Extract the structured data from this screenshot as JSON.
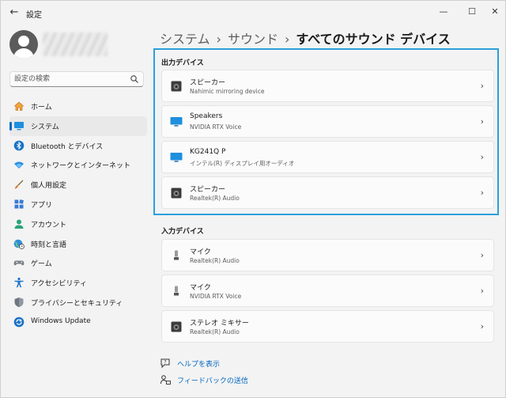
{
  "window": {
    "title": "設定",
    "back": "←",
    "controls": {
      "minimize": "—",
      "maximize": "☐",
      "close": "✕"
    }
  },
  "search": {
    "placeholder": "設定の検索"
  },
  "sidebar": {
    "items": [
      {
        "label": "ホーム",
        "icon": "home-icon",
        "active": false
      },
      {
        "label": "システム",
        "icon": "display-icon",
        "active": true
      },
      {
        "label": "Bluetooth とデバイス",
        "icon": "bluetooth-icon",
        "active": false
      },
      {
        "label": "ネットワークとインターネット",
        "icon": "wifi-icon",
        "active": false
      },
      {
        "label": "個人用設定",
        "icon": "brush-icon",
        "active": false
      },
      {
        "label": "アプリ",
        "icon": "apps-icon",
        "active": false
      },
      {
        "label": "アカウント",
        "icon": "person-icon",
        "active": false
      },
      {
        "label": "時刻と言語",
        "icon": "globe-clock-icon",
        "active": false
      },
      {
        "label": "ゲーム",
        "icon": "gamepad-icon",
        "active": false
      },
      {
        "label": "アクセシビリティ",
        "icon": "accessibility-icon",
        "active": false
      },
      {
        "label": "プライバシーとセキュリティ",
        "icon": "shield-icon",
        "active": false
      },
      {
        "label": "Windows Update",
        "icon": "windows-update-icon",
        "active": false
      }
    ]
  },
  "breadcrumb": {
    "items": [
      "システム",
      "サウンド"
    ],
    "current": "すべてのサウンド デバイス",
    "separator": "›"
  },
  "output_section": {
    "title": "出力デバイス",
    "devices": [
      {
        "name": "スピーカー",
        "sub": "Nahimic mirroring device",
        "icon": "speaker-icon"
      },
      {
        "name": "Speakers",
        "sub": "NVIDIA RTX Voice",
        "icon": "monitor-icon"
      },
      {
        "name": "KG241Q P",
        "sub": "インテル(R) ディスプレイ用オーディオ",
        "icon": "monitor-icon"
      },
      {
        "name": "スピーカー",
        "sub": "Realtek(R) Audio",
        "icon": "speaker-icon"
      }
    ]
  },
  "input_section": {
    "title": "入力デバイス",
    "devices": [
      {
        "name": "マイク",
        "sub": "Realtek(R) Audio",
        "icon": "microphone-icon"
      },
      {
        "name": "マイク",
        "sub": "NVIDIA RTX Voice",
        "icon": "microphone-icon"
      },
      {
        "name": "ステレオ ミキサー",
        "sub": "Realtek(R) Audio",
        "icon": "speaker-icon"
      }
    ]
  },
  "links": {
    "help": "ヘルプを表示",
    "feedback": "フィードバックの送信"
  },
  "colors": {
    "accent": "#0067c0",
    "highlight_border": "#2d9fdb"
  }
}
